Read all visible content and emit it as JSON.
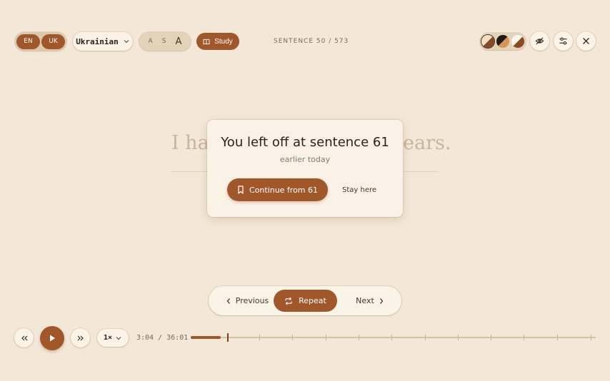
{
  "header": {
    "languages": [
      "EN",
      "UK"
    ],
    "target_language": "Ukrainian",
    "font_sizes": [
      "A",
      "S",
      "A"
    ],
    "study_label": "Study",
    "sentence_counter": "SENTENCE 50 / 573"
  },
  "reader": {
    "sentence_left": "I had",
    "sentence_right": "ears."
  },
  "resume_dialog": {
    "title": "You left off at sentence 61",
    "subtitle": "earlier today",
    "continue_label": "Continue from 61",
    "stay_label": "Stay here"
  },
  "navigation": {
    "previous_label": "Previous",
    "repeat_label": "Repeat",
    "next_label": "Next"
  },
  "player": {
    "speed": "1×",
    "time": "3:04 / 36:01",
    "progress_fraction": 0.085,
    "chapter_marks_fraction": [
      0.09,
      0.17,
      0.25,
      0.333,
      0.414,
      0.495,
      0.578,
      0.659,
      0.74,
      0.822,
      0.904,
      0.987
    ]
  },
  "colors": {
    "accent": "#a0582a",
    "background": "#f3e8d8",
    "surface": "#faf3e8"
  },
  "icons": {
    "study": "book-icon",
    "continue": "bookmark-icon",
    "repeat": "repeat-icon",
    "previous": "chevron-left-icon",
    "next": "chevron-right-icon",
    "visibility": "eye-off-icon",
    "settings": "sliders-icon",
    "close": "close-icon",
    "rewind": "rewind-icon",
    "play": "play-icon",
    "forward": "fast-forward-icon"
  }
}
